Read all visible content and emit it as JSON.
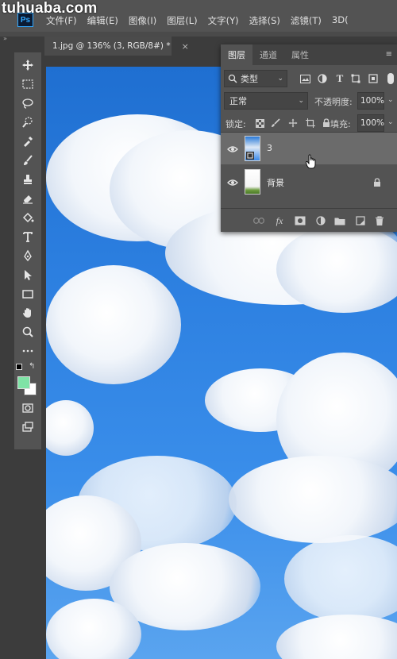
{
  "watermark": "tuhuaba.com",
  "app": {
    "logo": "Ps"
  },
  "menu": [
    "文件(F)",
    "编辑(E)",
    "图像(I)",
    "图层(L)",
    "文字(Y)",
    "选择(S)",
    "滤镜(T)",
    "3D("
  ],
  "document": {
    "tab_title": "1.jpg @ 136% (3, RGB/8#) *",
    "close_symbol": "×"
  },
  "toolbar": {
    "tools": [
      "move-tool",
      "marquee-tool",
      "lasso-tool",
      "quick-select-tool",
      "crop-tool",
      "eyedropper-tool",
      "brush-tool",
      "stamp-tool",
      "eraser-tool",
      "paint-bucket-tool",
      "type-tool",
      "pen-tool",
      "path-select-tool",
      "rectangle-tool",
      "hand-tool",
      "zoom-tool",
      "more-tools",
      "quick-mask",
      "screen-mode"
    ],
    "foreground_color": "#7fe3a6",
    "background_color": "#ffffff"
  },
  "layers_panel": {
    "tabs": [
      "图层",
      "通道",
      "属性"
    ],
    "active_tab": "图层",
    "filter": {
      "label": "类型"
    },
    "blend_mode": "正常",
    "opacity_label": "不透明度:",
    "opacity_value": "100%",
    "lock_label": "锁定:",
    "fill_label": "填充:",
    "fill_value": "100%",
    "layers": [
      {
        "name": "3",
        "selected": true,
        "visible": true
      },
      {
        "name": "背景",
        "selected": false,
        "visible": true,
        "locked": true
      }
    ]
  }
}
